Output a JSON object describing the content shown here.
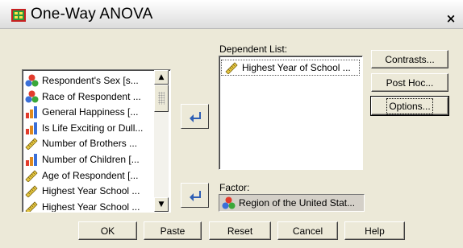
{
  "window": {
    "title": "One-Way ANOVA",
    "close_glyph": "×",
    "app_icon": "spss-dialog-icon"
  },
  "variables": {
    "items": [
      {
        "label": "Respondent's Sex [s...",
        "icon": "nominal-icon"
      },
      {
        "label": "Race of Respondent ...",
        "icon": "nominal-icon"
      },
      {
        "label": "General Happiness [...",
        "icon": "ordinal-icon"
      },
      {
        "label": "Is Life Exciting or Dull...",
        "icon": "ordinal-icon"
      },
      {
        "label": "Number of Brothers ...",
        "icon": "scale-icon"
      },
      {
        "label": "Number of Children [...",
        "icon": "ordinal-icon"
      },
      {
        "label": "Age of Respondent [...",
        "icon": "scale-icon"
      },
      {
        "label": "Highest Year School ...",
        "icon": "scale-icon"
      },
      {
        "label": "Highest Year School ...",
        "icon": "scale-icon"
      }
    ]
  },
  "dependent": {
    "label": "Dependent List:",
    "items": [
      {
        "label": "Highest Year of School ...",
        "icon": "scale-icon"
      }
    ]
  },
  "factor": {
    "label": "Factor:",
    "value": "Region of the United Stat...",
    "icon": "nominal-icon"
  },
  "side_buttons": {
    "contrasts": "Contrasts...",
    "post_hoc": "Post Hoc...",
    "options": "Options..."
  },
  "bottom_buttons": {
    "ok": "OK",
    "paste": "Paste",
    "reset": "Reset",
    "cancel": "Cancel",
    "help": "Help"
  },
  "colors": {
    "dialog_bg": "#ece9d8",
    "arrow_blue": "#2f5fb5"
  }
}
